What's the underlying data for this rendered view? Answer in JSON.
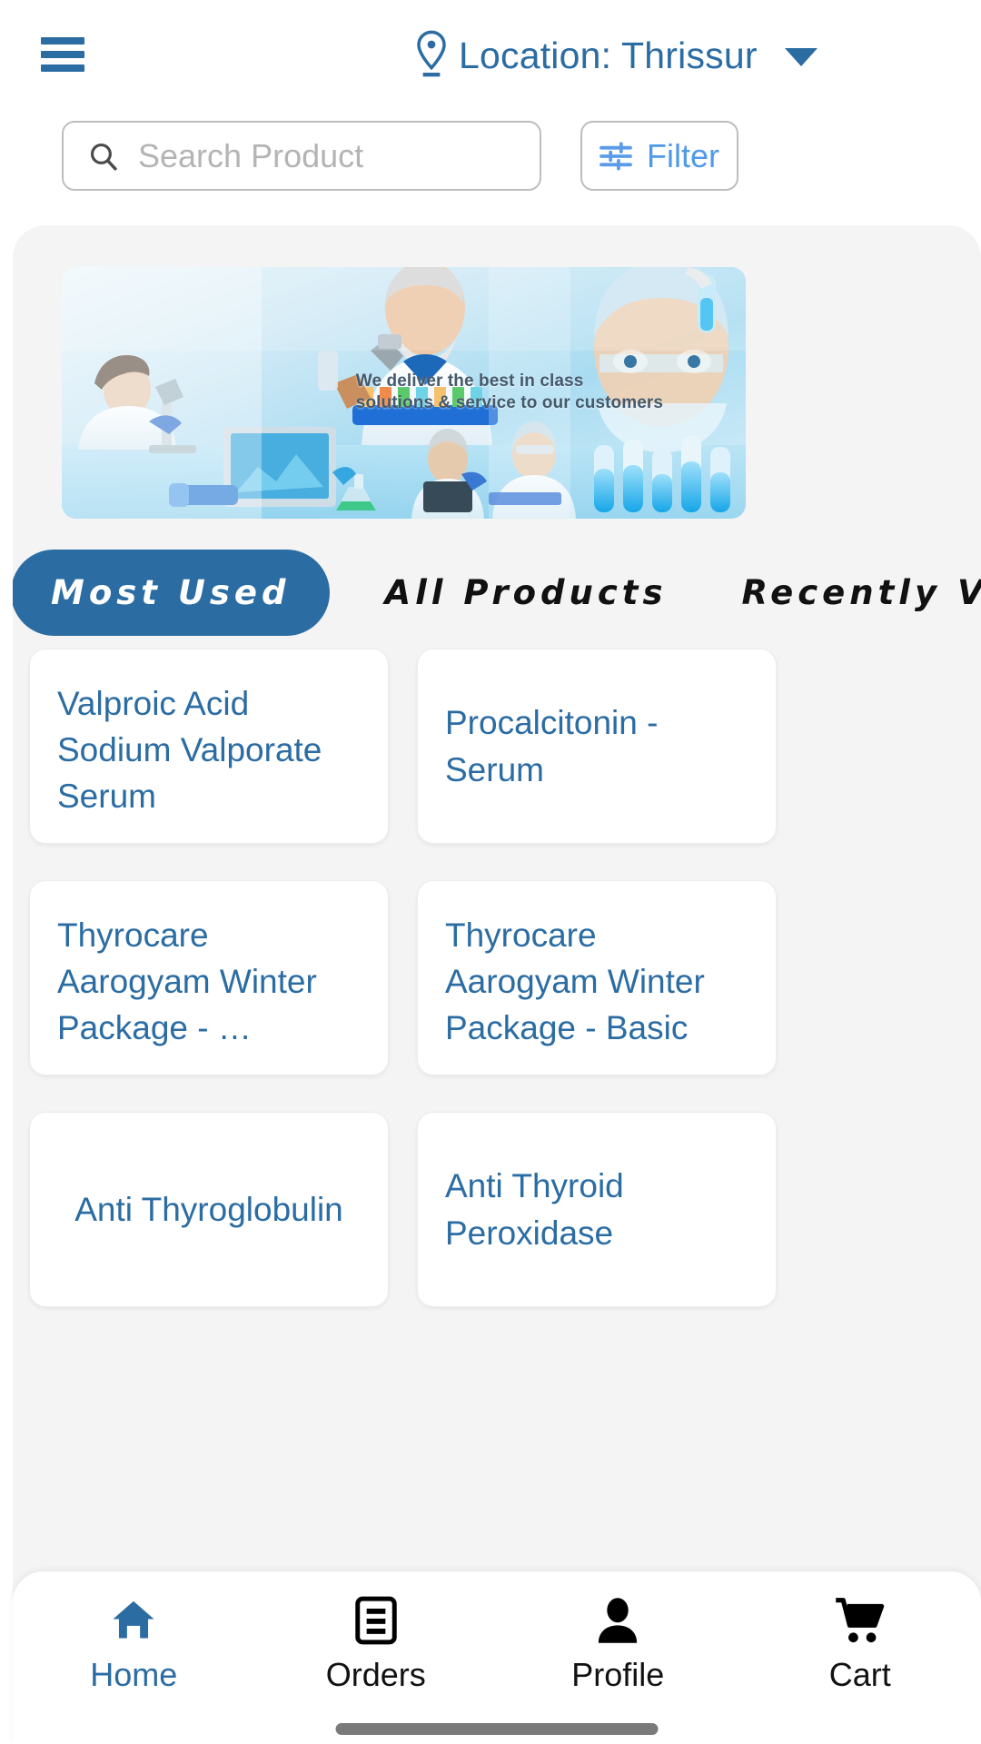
{
  "header": {
    "menu_icon": "hamburger-menu-icon",
    "location_pin_icon": "location-pin-icon",
    "location_label": "Location: Thrissur",
    "dropdown_icon": "chevron-down-icon",
    "accent_color": "#2b6ca3"
  },
  "search": {
    "icon": "search-icon",
    "value": "",
    "placeholder": "Search Product"
  },
  "filter": {
    "icon": "filter-sliders-icon",
    "label": "Filter",
    "color": "#4f9ae8"
  },
  "banner": {
    "alt": "laboratory-scientists-banner",
    "headline_line1": "We deliver the best in class",
    "headline_line2": "solutions & service to our customers"
  },
  "tabs": [
    {
      "label": "Most Used",
      "active": true
    },
    {
      "label": "All Products",
      "active": false
    },
    {
      "label": "Recently V",
      "active": false
    }
  ],
  "products": [
    {
      "title": "Valproic Acid Sodium Valporate Serum",
      "align": "top"
    },
    {
      "title": "Procalcitonin - Serum",
      "align": "mid"
    },
    {
      "title": "Thyrocare Aarogyam  Winter Package - …",
      "align": "top"
    },
    {
      "title": "Thyrocare Aarogyam  Winter Package - Basic",
      "align": "top"
    },
    {
      "title": "Anti Thyroglobulin",
      "align": "center"
    },
    {
      "title": "Anti Thyroid Peroxidase",
      "align": "mid"
    }
  ],
  "bottom_nav": [
    {
      "label": "Home",
      "icon": "home-icon",
      "active": true
    },
    {
      "label": "Orders",
      "icon": "orders-icon",
      "active": false
    },
    {
      "label": "Profile",
      "icon": "profile-icon",
      "active": false
    },
    {
      "label": "Cart",
      "icon": "cart-icon",
      "active": false
    }
  ]
}
